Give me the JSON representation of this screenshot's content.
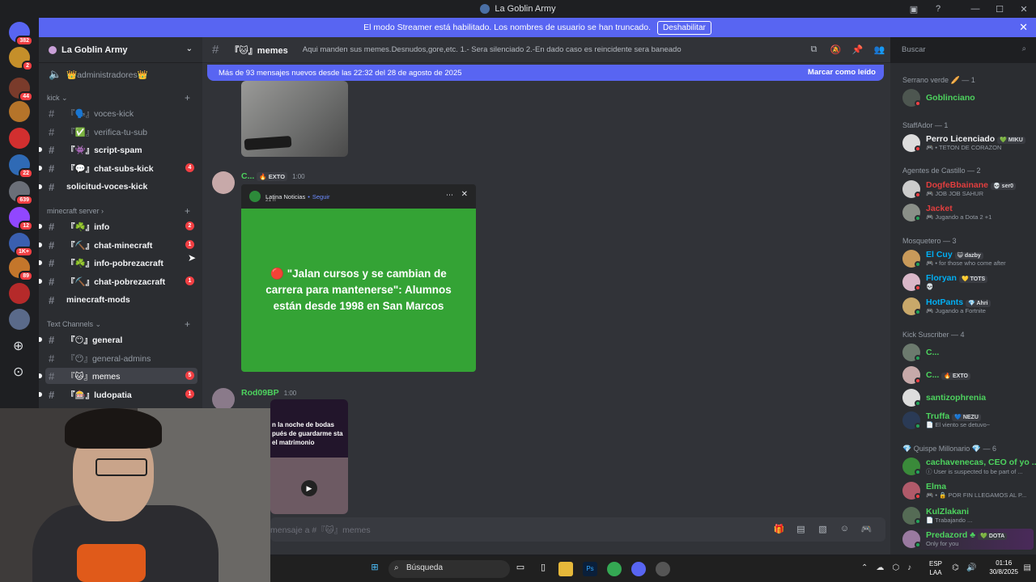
{
  "window": {
    "title": "La Goblin Army"
  },
  "banner": {
    "text": "El modo Streamer está habilitado. Los nombres de usuario se han truncado.",
    "button": "Deshabilitar"
  },
  "guild_badges": [
    "382",
    "2",
    "44",
    "",
    "",
    "22",
    "639",
    "12",
    "1K+",
    "89",
    "",
    ""
  ],
  "server": {
    "name": "La Goblin Army"
  },
  "channels": {
    "top": {
      "name": "👑administradores👑"
    },
    "kick_category": "kick",
    "kick": [
      {
        "name": "『🗣️』voces-kick",
        "badge": ""
      },
      {
        "name": "『✅』verifica-tu-sub",
        "badge": ""
      },
      {
        "name": "『👾』script-spam",
        "badge": ""
      },
      {
        "name": "『💬』chat-subs-kick",
        "badge": "4"
      },
      {
        "name": "solicitud-voces-kick",
        "badge": ""
      }
    ],
    "mc_category": "minecraft server",
    "mc": [
      {
        "name": "『☘️』info",
        "badge": "2"
      },
      {
        "name": "『⛏️』chat-minecraft",
        "badge": "1"
      },
      {
        "name": "『☘️』info-pobrezacraft",
        "badge": ""
      },
      {
        "name": "『⛏️』chat-pobrezacraft",
        "badge": "1"
      },
      {
        "name": "minecraft-mods",
        "badge": ""
      }
    ],
    "text_category": "Text Channels",
    "text": [
      {
        "name": "『😶』general",
        "badge": ""
      },
      {
        "name": "『😶』general-admins",
        "badge": ""
      },
      {
        "name": "『🐱』memes",
        "badge": "5"
      },
      {
        "name": "『🎰』ludopatia",
        "badge": "1"
      }
    ]
  },
  "header": {
    "channel": "『🐱』memes",
    "topic": "Aqui manden sus memes.Desnudos,gore,etc. 1.- Sera silenciado 2.-En dado caso es reincidente sera baneado"
  },
  "search": {
    "placeholder": "Buscar"
  },
  "newbar": {
    "text": "Más de 93 mensajes nuevos desde las 22:32 del 28 de agosto de 2025",
    "mark": "Marcar como leído"
  },
  "messages": [
    {
      "user": "C...",
      "tag": "🔥 EXTO",
      "time": "1:00"
    },
    {
      "user": "Rod09BP",
      "time": "1:00"
    }
  ],
  "embed": {
    "source": "Latina Noticias",
    "follow": "Seguir",
    "when": "21 h",
    "headline": "🔴 \"Jalan cursos y se cambian de carrera para mantenerse\": Alumnos están desde 1998 en San Marcos"
  },
  "video": {
    "text": "n la noche de bodas pués de guardarme sta el matrimonio"
  },
  "composer": {
    "placeholder": "mensaje a #『🐱』memes"
  },
  "members": {
    "sections": [
      "Serrano verde 🥖 — 1",
      "StaffAdor — 1",
      "Agentes de Castillo — 2",
      "Mosquetero — 3",
      "Kick Suscriber — 4",
      "💎 Quispe Millonario 💎 — 6"
    ],
    "list": [
      {
        "name": "Goblinciano",
        "status": "",
        "tag": "",
        "color": "#4dd35e"
      },
      {
        "name": "Perro Licenciado",
        "status": "🎮 • TETON DE CORAZON",
        "tag": "💚 MIKU",
        "color": "#f2f3f5"
      },
      {
        "name": "DogfeBbainane",
        "status": "🎮 JOB JOB SAHUR",
        "tag": "💀 ser0",
        "color": "#e23e3e"
      },
      {
        "name": "Jacket",
        "status": "🎮 Jugando a Dota 2 +1",
        "tag": "",
        "color": "#e23e3e"
      },
      {
        "name": "El Cuy",
        "status": "🎮 • for those who come after",
        "tag": "😺 dazby",
        "color": "#00aff4"
      },
      {
        "name": "Floryan",
        "status": "💀",
        "tag": "💛 TOTS",
        "color": "#00aff4"
      },
      {
        "name": "HotPants",
        "status": "🎮 Jugando a Fortnite",
        "tag": "💎 Ahri",
        "color": "#00aff4"
      },
      {
        "name": "C...",
        "status": "",
        "tag": "",
        "color": "#4dd35e"
      },
      {
        "name": "C...",
        "status": "",
        "tag": "🔥 EXTO",
        "color": "#4dd35e"
      },
      {
        "name": "santizophrenia",
        "status": "",
        "tag": "",
        "color": "#4dd35e"
      },
      {
        "name": "Truffa",
        "status": "📄 El viento se detuvo~",
        "tag": "💙 NEZU",
        "color": "#4dd35e"
      },
      {
        "name": "cachavenecas, CEO of yo ...",
        "status": "ⓘ User is suspected to be part of ...",
        "tag": "",
        "color": "#4dd35e"
      },
      {
        "name": "Elma",
        "status": "🎮 • 🔒 POR FIN LLEGAMOS AL P...",
        "tag": "",
        "color": "#4dd35e"
      },
      {
        "name": "KulZlakani",
        "status": "📄 Trabajando ...",
        "tag": "",
        "color": "#4dd35e"
      },
      {
        "name": "Predazord ♣",
        "status": "Only for you",
        "tag": "💚 DOTA",
        "color": "#4dd35e"
      }
    ]
  },
  "taskbar": {
    "search": "Búsqueda",
    "lang1": "ESP",
    "lang2": "LAA",
    "time": "01:16",
    "date": "30/8/2025"
  }
}
